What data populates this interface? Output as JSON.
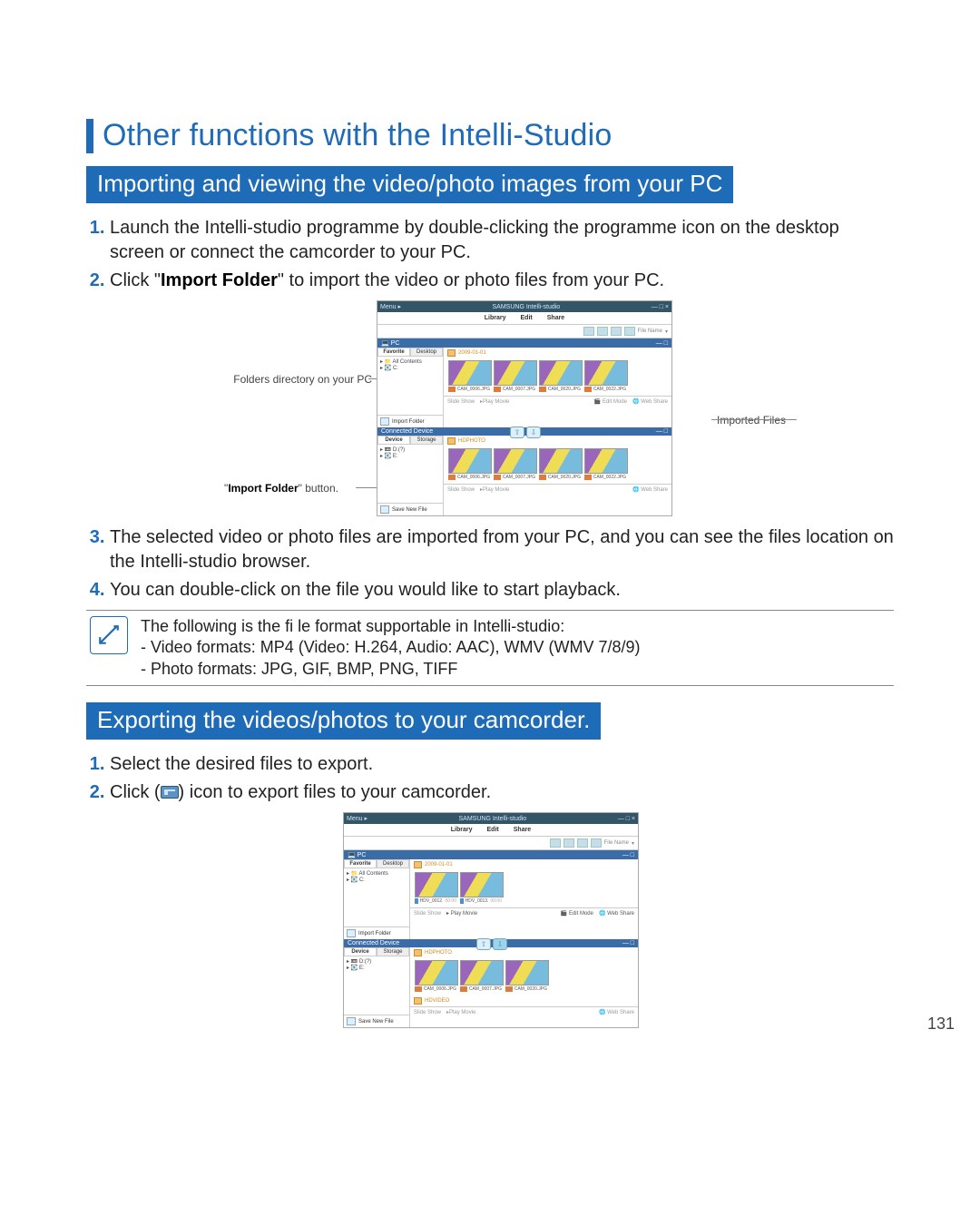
{
  "page": {
    "title": "Other functions with the Intelli-Studio",
    "number": "131"
  },
  "section1": {
    "heading": "Importing and viewing the video/photo images from your PC",
    "step1": "Launch the Intelli-studio programme by double-clicking the programme icon on the desktop screen or connect the camcorder to your PC.",
    "step2_pre": "Click \"",
    "step2_bold": "Import Folder",
    "step2_post": "\" to import the video or photo files from your PC.",
    "step3": "The selected video or photo files are imported from your PC, and you can see the files location on the Intelli-studio browser.",
    "step4": "You can double-click on the file you would like to start playback."
  },
  "callouts": {
    "folders": "Folders directory on your PC",
    "import_pre": "\"",
    "import_b": "Import Folder",
    "import_post": "\" button.",
    "imported": "Imported Files"
  },
  "app": {
    "menu": "Menu ▸",
    "brand": "SAMSUNG Intelli-studio",
    "winbtns": "— □ ×",
    "tabs": {
      "library": "Library",
      "edit": "Edit",
      "share": "Share"
    },
    "toolbar_label": "File Name",
    "pc": "PC",
    "bandbtns": "— □",
    "side1": {
      "fav": "Favorite",
      "desk": "Desktop",
      "tree": "▸ 📁 All Contents",
      "tree2": "▸ 💽 C:"
    },
    "side2": {
      "dev": "Device",
      "sto": "Storage",
      "tree": "▸ 📼 D:(?)",
      "tree2": "▸ 💽 E:"
    },
    "import": "Import Folder",
    "save": "Save New File",
    "folder1": "2009-01-01",
    "folder2": "HDPHOTO",
    "folder3": "HDVIDEO",
    "thumbsA": [
      "CAM_0006.JPG",
      "CAM_0007.JPG",
      "CAM_0020.JPG",
      "CAM_0022.JPG"
    ],
    "thumbsV": [
      {
        "n": "HDV_0012.",
        "t": "00:00"
      },
      {
        "n": "HDV_0013.",
        "t": "00:00"
      }
    ],
    "mid": {
      "slide": "Slide Show",
      "play": "Play Movie",
      "editmode": "Edit Mode",
      "web": "Web Share"
    },
    "connected": "Connected Device"
  },
  "note": {
    "line1": "The following is the fi le format supportable in Intelli-studio:",
    "line2": "-   Video formats: MP4 (Video: H.264, Audio: AAC), WMV (WMV 7/8/9)",
    "line3": "-   Photo formats: JPG, GIF, BMP, PNG, TIFF"
  },
  "section2": {
    "heading": "Exporting the videos/photos to your camcorder.",
    "step1": "Select the desired files to export.",
    "step2_pre": "Click (",
    "step2_post": ") icon to export files to your camcorder."
  }
}
